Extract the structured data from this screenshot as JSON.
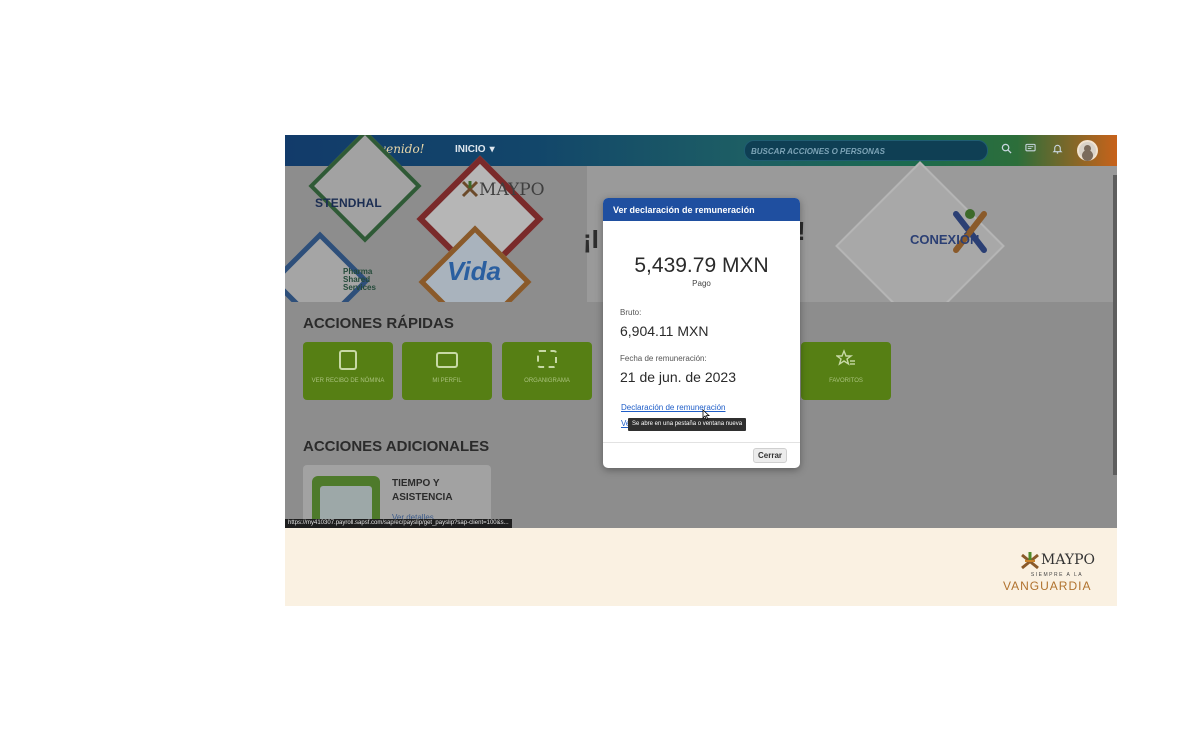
{
  "header": {
    "welcome": "¡Bienvenido!",
    "nav_home": "INICIO",
    "search_placeholder": "BUSCAR ACCIONES O PERSONAS"
  },
  "banner": {
    "brands": {
      "stendhal": "STENDHAL",
      "maypo": "MAYPO",
      "pharma": "Pharma Shared Services",
      "vida": "Vida",
      "conexion": "CONEXIÓN"
    },
    "greeting_left": "¡I",
    "greeting_right": "!"
  },
  "quick_actions": {
    "title": "ACCIONES RÁPIDAS",
    "tiles": [
      {
        "label": "VER RECIBO DE NÓMINA"
      },
      {
        "label": "MI PERFIL"
      },
      {
        "label": "ORGANIGRAMA"
      },
      {
        "label": "FAVORITOS"
      }
    ]
  },
  "additional_actions": {
    "title": "ACCIONES ADICIONALES",
    "card_title": "TIEMPO Y ASISTENCIA",
    "card_link": "Ver detalles"
  },
  "status_url": "https://my410307.payroll.sapsf.com/sap/ec/payslip/get_payslip?sap-client=100&s...",
  "modal": {
    "title": "Ver declaración de remuneración",
    "amount": "5,439.79 MXN",
    "amount_label": "Pago",
    "gross_label": "Bruto:",
    "gross_value": "6,904.11 MXN",
    "date_label": "Fecha de remuneración:",
    "date_value": "21 de jun. de 2023",
    "link_statement": "Declaración de remuneración",
    "link_second": "Ve",
    "tooltip": "Se abre en una pestaña o ventana nueva",
    "close": "Cerrar"
  },
  "footer": {
    "brand": "MAYPO",
    "tagline_top": "SIEMPRE A LA",
    "tagline_bottom": "VANGUARDIA"
  },
  "colors": {
    "header_blue": "#123b6a",
    "modal_header": "#1f4fa0",
    "tile_green": "#567f14",
    "footer_bg": "#faf1e2",
    "link_blue": "#1f5ec8"
  },
  "icons": [
    "search-icon",
    "chat-icon",
    "bell-icon",
    "user-avatar-icon",
    "chevron-down-icon",
    "payslip-icon",
    "profile-card-icon",
    "org-chart-icon",
    "favorites-star-icon",
    "pointer-cursor-icon"
  ]
}
